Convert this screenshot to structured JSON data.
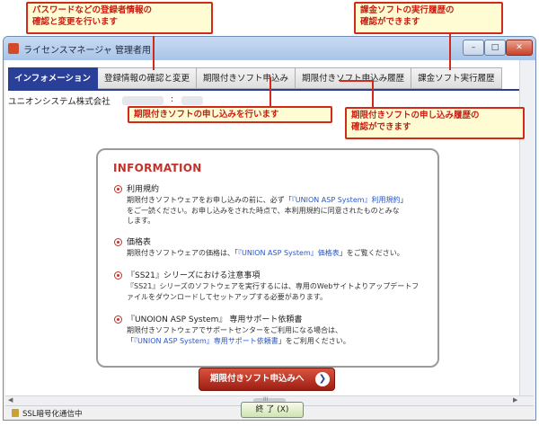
{
  "window": {
    "title": "ライセンスマネージャ 管理者用",
    "min_glyph": "–",
    "max_glyph": "□",
    "close_glyph": "✕"
  },
  "tabs": [
    {
      "label": "インフォメーション",
      "active": true
    },
    {
      "label": "登録情報の確認と変更",
      "active": false
    },
    {
      "label": "期限付きソフト申込み",
      "active": false
    },
    {
      "label": "期限付きソフト申込み履歴",
      "active": false
    },
    {
      "label": "課金ソフト実行履歴",
      "active": false
    }
  ],
  "company": {
    "name": "ユニオンシステム株式会社",
    "separator": ":"
  },
  "info": {
    "heading": "INFORMATION",
    "items": [
      {
        "title": "利用規約",
        "line1_pre": "期限付きソフトウェアをお申し込みの前に、必ず「",
        "line1_link": "『UNION ASP System』利用規約",
        "line1_post": "」",
        "line2": "をご一読ください。お申し込みをされた時点で、本利用規約に同意されたものとみな",
        "line3": "します。"
      },
      {
        "title": "価格表",
        "line1_pre": "期限付きソフトウェアの価格は、「",
        "line1_link": "『UNION ASP System』価格表",
        "line1_post": "」をご覧ください。"
      },
      {
        "title": "『SS21』シリーズにおける注意事項",
        "line1": "『SS21』シリーズのソフトウェアを実行するには、専用のWebサイトよりアップデートフ",
        "line2": "ァイルをダウンロードしてセットアップする必要があります。"
      },
      {
        "title": "『UNOION ASP System』 専用サポート依頼書",
        "line1": "期限付きソフトウェアでサポートセンターをご利用になる場合は、",
        "line2_pre": "「",
        "line2_link": "『UNION ASP System』専用サポート依頼書",
        "line2_post": "」をご利用ください。"
      }
    ]
  },
  "apply_button": {
    "label": "期限付きソフト申込みへ",
    "icon": "❯"
  },
  "status": {
    "text": "SSL暗号化通信中"
  },
  "exit_button": {
    "label": "終 了 (X)"
  },
  "scroll": {
    "left_glyph": "◀",
    "right_glyph": "▶",
    "grip_glyph": "III"
  },
  "callouts": {
    "top_left": {
      "line1": "パスワードなどの登録者情報の",
      "line2": "確認と変更を行います"
    },
    "top_right": {
      "line1": "課金ソフトの実行履歴の",
      "line2": "確認ができます"
    },
    "mid_left": {
      "line1": "期限付きソフトの申し込みを行います"
    },
    "mid_right": {
      "line1": "期限付きソフトの申し込み履歴の",
      "line2": "確認ができます"
    }
  },
  "colors": {
    "tab_active": "#2a3f98",
    "accent_red": "#c2312a",
    "callout_border": "#d12a1c",
    "callout_bg": "#fffcd4",
    "link": "#2a56c8"
  }
}
